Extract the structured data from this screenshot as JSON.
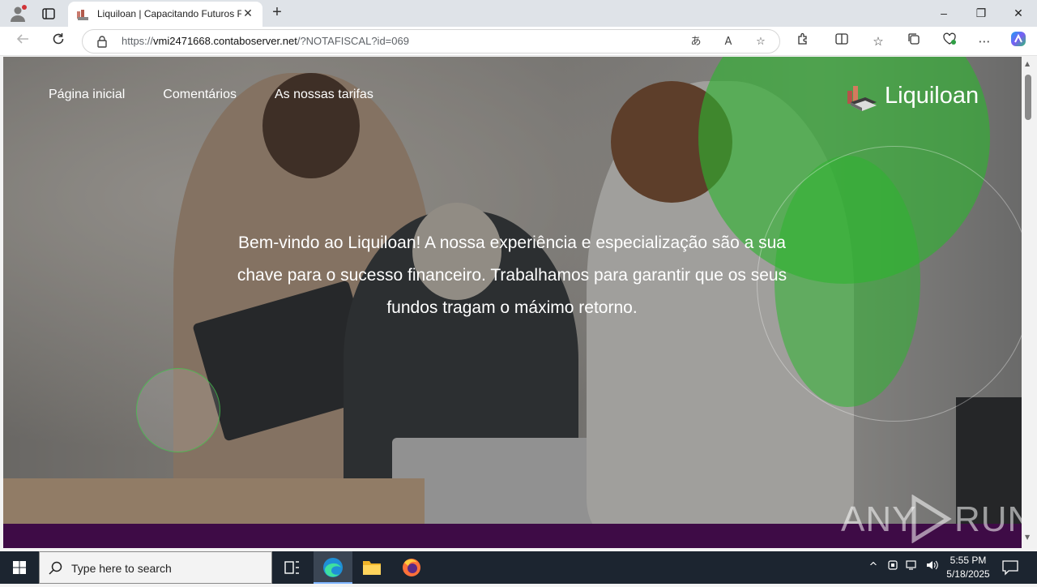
{
  "browser": {
    "tab_title": "Liquiloan | Capacitando Futuros F",
    "tab_close": "✕",
    "new_tab": "+",
    "url_prefix": "https://",
    "url_host": "vmi2471668.contaboserver.net",
    "url_path": "/?NOTAFISCAL?id=069",
    "window_controls": {
      "minimize": "–",
      "maximize": "❐",
      "close": "✕"
    }
  },
  "page": {
    "nav": [
      "Página inicial",
      "Comentários",
      "As nossas tarifas"
    ],
    "logo_text": "Liquiloan",
    "headline": "Bem-vindo ao Liquiloan! A nossa experiência e especialização são a sua chave para o sucesso financeiro. Trabalhamos para garantir que os seus fundos tragam o máximo retorno.",
    "accent_color": "#2db52f",
    "footer_strip_color": "#3e0b46"
  },
  "watermark": {
    "text_left": "ANY",
    "text_right": "RUN"
  },
  "taskbar": {
    "search_placeholder": "Type here to search",
    "time": "5:55 PM",
    "date": "5/18/2025",
    "apps": [
      "task-view",
      "edge",
      "file-explorer",
      "firefox"
    ]
  }
}
